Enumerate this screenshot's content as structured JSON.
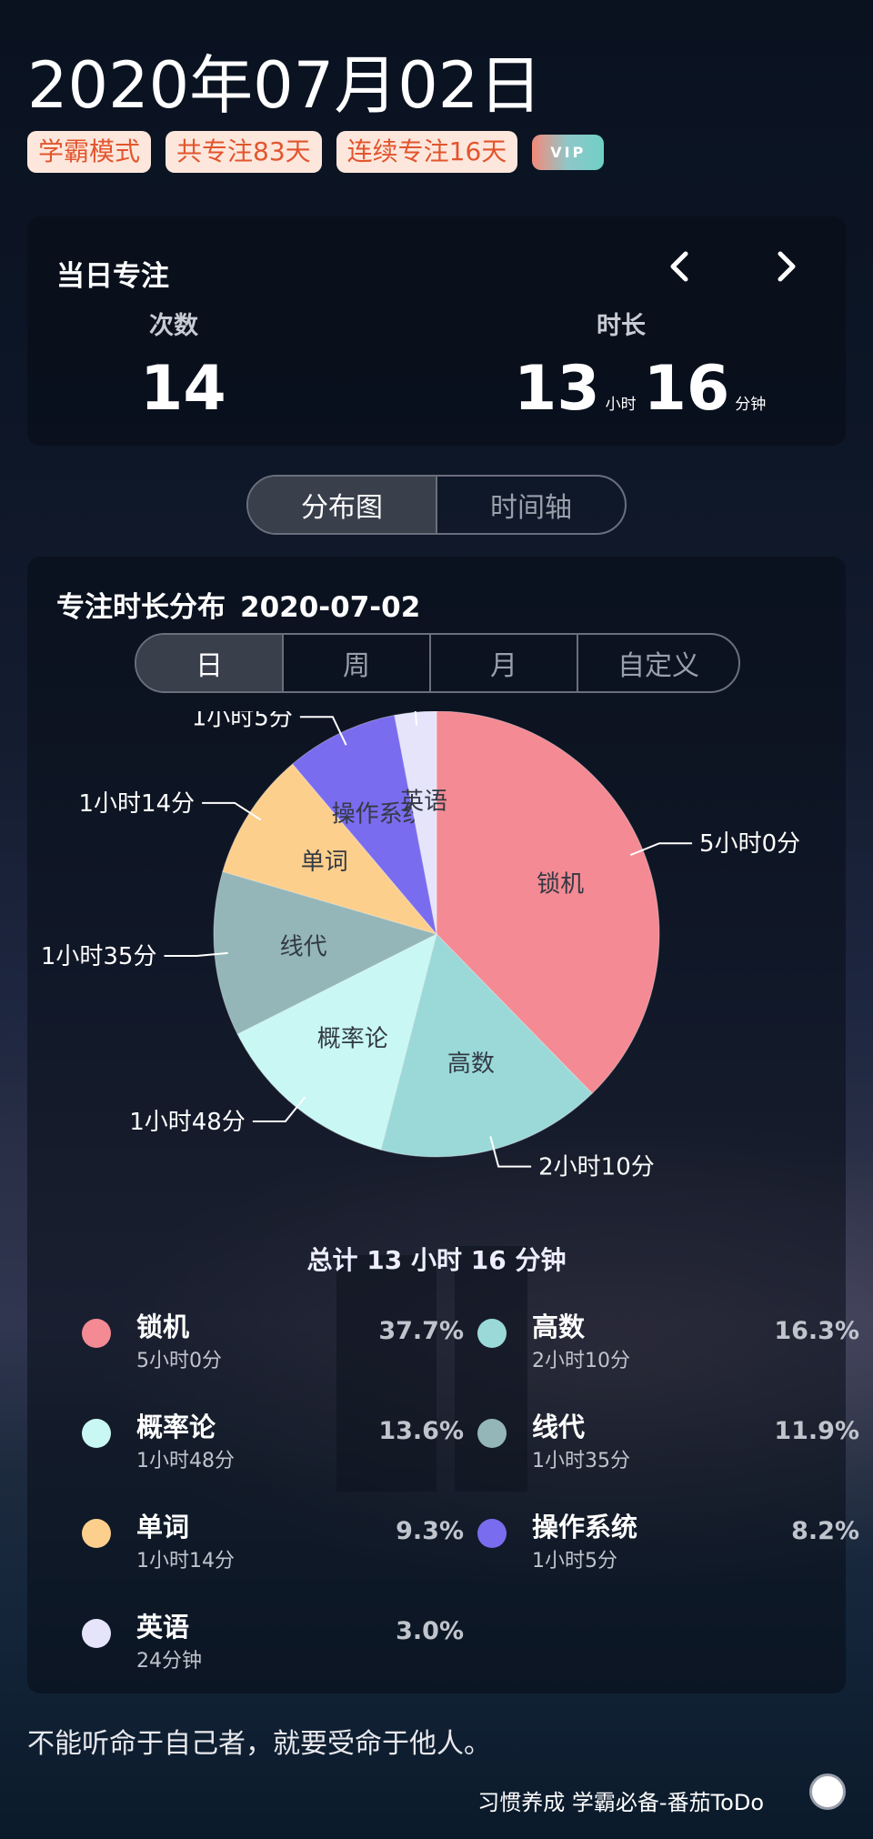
{
  "header": {
    "date": "2020年07月02日",
    "badges": [
      "学霸模式",
      "共专注83天",
      "连续专注16天"
    ],
    "vip": "VIP"
  },
  "daily": {
    "title": "当日专注",
    "count_label": "次数",
    "count_value": "14",
    "duration_label": "时长",
    "hours": "13",
    "hours_unit": "小时",
    "minutes": "16",
    "minutes_unit": "分钟"
  },
  "view_tabs": [
    "分布图",
    "时间轴"
  ],
  "distribution": {
    "title": "专注时长分布",
    "date": "2020-07-02",
    "period_tabs": [
      "日",
      "周",
      "月",
      "自定义"
    ],
    "total": "总计 13 小时 16 分钟"
  },
  "chart_data": {
    "type": "pie",
    "slices": [
      {
        "name": "锁机",
        "duration": "5小时0分",
        "minutes": 300,
        "percent": "37.7%",
        "color": "#f48a93"
      },
      {
        "name": "高数",
        "duration": "2小时10分",
        "minutes": 130,
        "percent": "16.3%",
        "color": "#9bd9d8"
      },
      {
        "name": "概率论",
        "duration": "1小时48分",
        "minutes": 108,
        "percent": "13.6%",
        "color": "#c9f7f4"
      },
      {
        "name": "线代",
        "duration": "1小时35分",
        "minutes": 95,
        "percent": "11.9%",
        "color": "#94b6b9"
      },
      {
        "name": "单词",
        "duration": "1小时14分",
        "minutes": 74,
        "percent": "9.3%",
        "color": "#fdcf8c"
      },
      {
        "name": "操作系统",
        "duration": "1小时5分",
        "minutes": 65,
        "percent": "8.2%",
        "color": "#7a6cee"
      },
      {
        "name": "英语",
        "duration": "24分钟",
        "minutes": 24,
        "percent": "3.0%",
        "color": "#e6e4fb"
      }
    ]
  },
  "footer": {
    "quote": "不能听命于自己者，就要受命于他人。",
    "slogan": "习惯养成 学霸必备-番茄ToDo"
  }
}
